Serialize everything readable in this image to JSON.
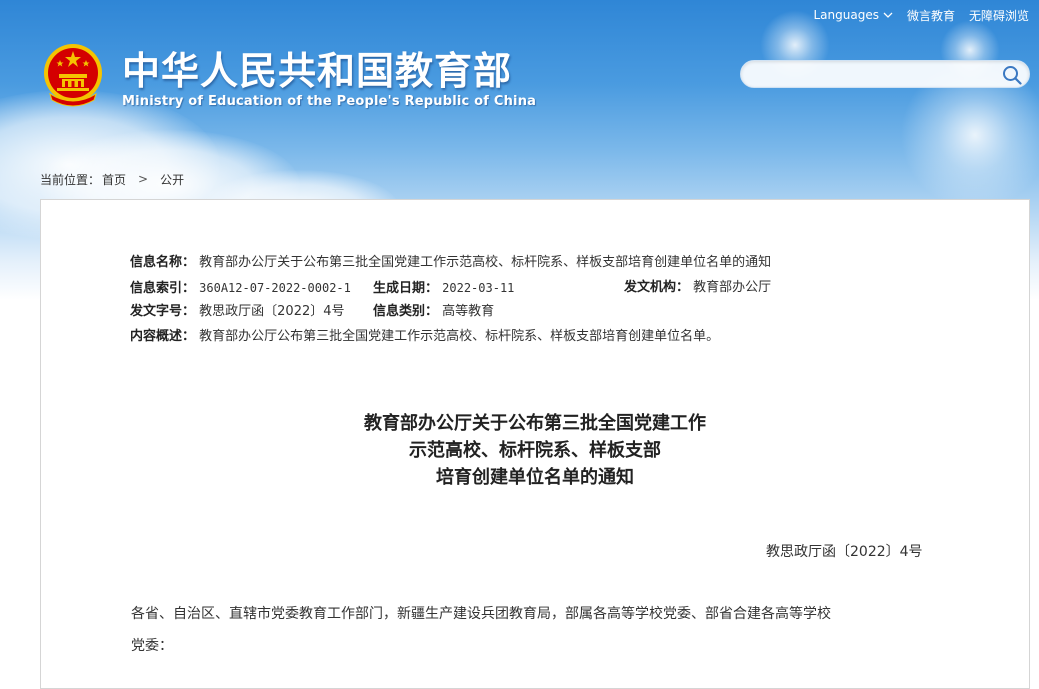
{
  "header": {
    "top_links": {
      "languages": "Languages",
      "weiyan": "微言教育",
      "accessibility": "无障碍浏览"
    },
    "title": "中华人民共和国教育部",
    "subtitle": "Ministry of Education of the People's Republic of China",
    "search": {
      "placeholder": "",
      "value": ""
    },
    "colors": {
      "sky": "#2f86d6",
      "emblem_red": "#d40000",
      "emblem_gold": "#f5c400"
    }
  },
  "breadcrumb": {
    "prefix": "当前位置：",
    "items": [
      "首页",
      "公开"
    ],
    "separator": ">"
  },
  "info": {
    "name_label": "信息名称：",
    "name_value": "教育部办公厅关于公布第三批全国党建工作示范高校、标杆院系、样板支部培育创建单位名单的通知",
    "index_label": "信息索引：",
    "index_value": "360A12-07-2022-0002-1",
    "date_label": "生成日期：",
    "date_value": "2022-03-11",
    "org_label": "发文机构：",
    "org_value": "教育部办公厅",
    "docno_label": "发文字号：",
    "docno_value": "教思政厅函〔2022〕4号",
    "category_label": "信息类别：",
    "category_value": "高等教育",
    "summary_label": "内容概述：",
    "summary_value": "教育部办公厅公布第三批全国党建工作示范高校、标杆院系、样板支部培育创建单位名单。"
  },
  "document": {
    "title_lines": [
      "教育部办公厅关于公布第三批全国党建工作",
      "示范高校、标杆院系、样板支部",
      "培育创建单位名单的通知"
    ],
    "number": "教思政厅函〔2022〕4号",
    "salutation_line1": "各省、自治区、直辖市党委教育工作部门，新疆生产建设兵团教育局，部属各高等学校党委、部省合建各高等学校",
    "salutation_line2": "党委："
  }
}
